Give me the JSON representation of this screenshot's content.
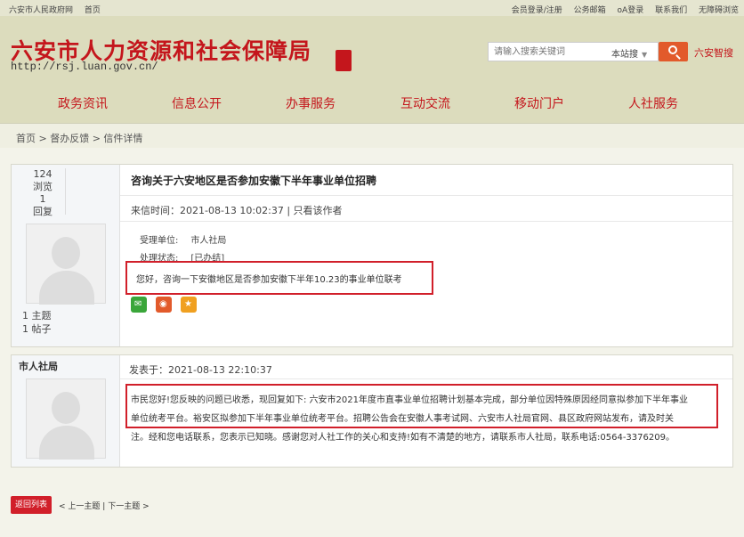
{
  "topbar": {
    "site_name": "六安市人民政府网",
    "home": "首页",
    "login": "会员登录/注册",
    "mail": "公务邮箱",
    "oa": "oA登录",
    "contact": "联系我们",
    "accessible": "无障碍浏览"
  },
  "header": {
    "title": "六安市人力资源和社会保障局",
    "url": "http://rsj.luan.gov.cn/",
    "search_placeholder": "请输入搜索关键词",
    "search_scope": "本站搜",
    "smart_link": "六安智搜"
  },
  "nav": [
    "政务资讯",
    "信息公开",
    "办事服务",
    "互动交流",
    "移动门户",
    "人社服务"
  ],
  "breadcrumb": "首页 > 督办反馈 > 信件详情",
  "post": {
    "views": "124",
    "views_label": "浏览",
    "replies": "1",
    "replies_label": "回复",
    "topics": "1 主题",
    "posts": "1 帖子",
    "title": "咨询关于六安地区是否参加安徽下半年事业单位招聘",
    "meta": "来信时间：2021-08-13 10:02:37 | 只看该作者",
    "dept_label": "受理单位:",
    "dept_value": "市人社局",
    "status_label": "处理状态:",
    "status_value": "[已办结]",
    "question": "您好，咨询一下安徽地区是否参加安徽下半年10.23的事业单位联考"
  },
  "reply": {
    "author": "市人社局",
    "meta": "发表于：2021-08-13 22:10:37",
    "line1": "市民您好!您反映的问题已收悉，现回复如下: 六安市2021年度市直事业单位招聘计划基本完成，部分单位因特殊原因经同意拟参加下半年事业",
    "line2": "单位统考平台。裕安区拟参加下半年事业单位统考平台。招聘公告会在安徽人事考试网、六安市人社局官网、县区政府网站发布，请及时关",
    "line3": "注。经和您电话联系，您表示已知晓。感谢您对人社工作的关心和支持!如有不清楚的地方，请联系市人社局，联系电话:0564-3376209。"
  },
  "footer": {
    "back": "返回列表",
    "prev": "< 上一主题",
    "sep": "|",
    "next": "下一主题 >"
  }
}
